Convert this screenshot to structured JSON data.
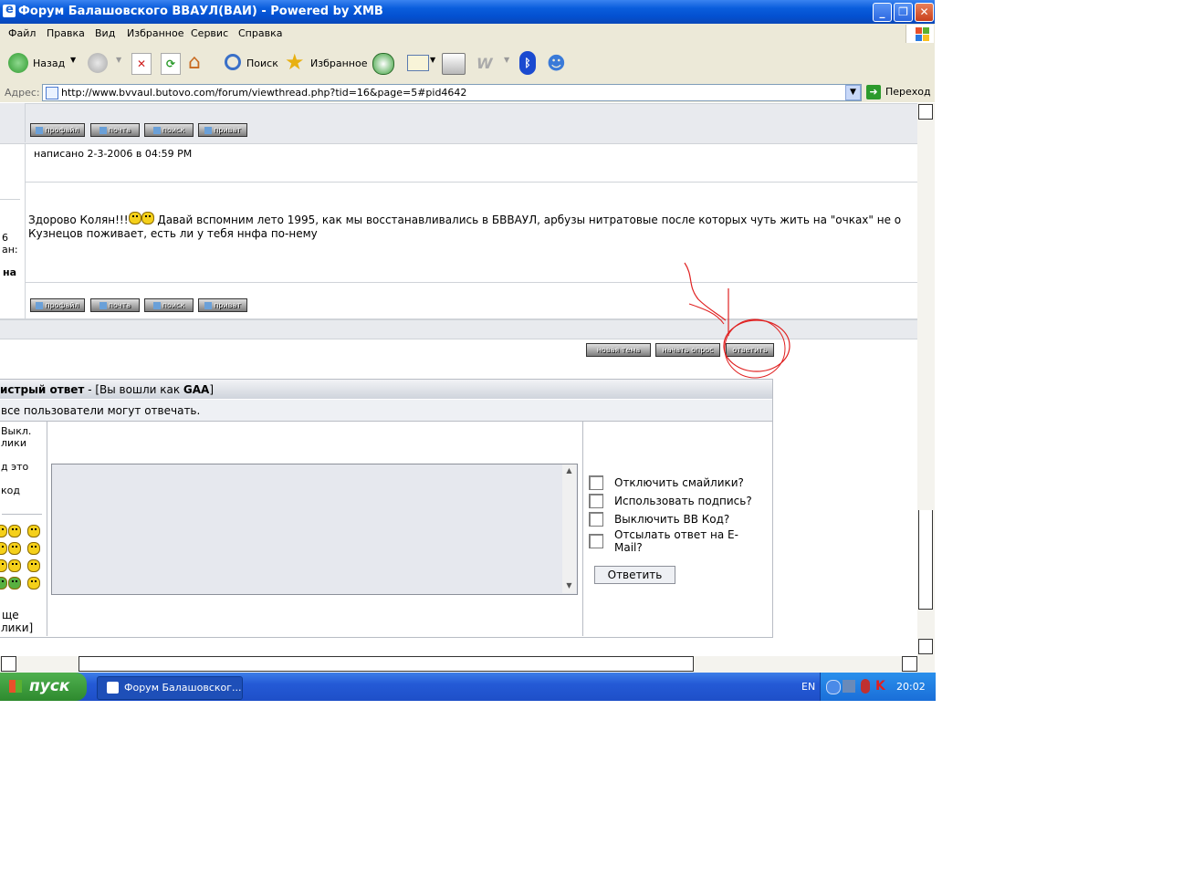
{
  "window": {
    "title": "Форум Балашовского ВВАУЛ(ВАИ) - Powered by XMB",
    "minimize_label": "_",
    "restore_label": "❐",
    "close_label": "✕"
  },
  "menu": [
    "Файл",
    "Правка",
    "Вид",
    "Избранное",
    "Сервис",
    "Справка"
  ],
  "toolbar": {
    "back_label": "Назад",
    "search_label": "Поиск",
    "favorites_label": "Избранное"
  },
  "address": {
    "label": "Адрес:",
    "url": "http://www.bvvaul.butovo.com/forum/viewthread.php?tid=16&page=5#pid4642",
    "go_label": "Переход"
  },
  "post": {
    "buttons": [
      "профайл",
      "почта",
      "поиск",
      "приват"
    ],
    "posted": "написано 2-3-2006 в 04:59 PM",
    "body_line1_a": "Здорово Колян!!!",
    "body_line1_b": "Давай вспомним лето 1995, как мы восстанавливались в БВВАУЛ, арбузы нитратовые после которых чуть жить на \"очках\" не о",
    "body_line2": "Кузнецов поживает, есть ли у тебя ннфа по-нему",
    "side_fragment1": "6",
    "side_fragment2": "ан:",
    "side_fragment3": "на"
  },
  "thread_actions": [
    "новая тема",
    "начать опрос",
    "ответить"
  ],
  "quick_reply": {
    "title": "истрый ответ",
    "logged_in_prefix": " - [Вы вошли как ",
    "user": "GAA",
    "logged_in_suffix": "]",
    "note": "все пользователи могут отвечать.",
    "left_labels": [
      "Выкл.",
      "лики",
      "д это",
      "код"
    ],
    "more_smilies_1": "ще",
    "more_smilies_2": "лики]",
    "options": [
      "Отключить смайлики?",
      "Использовать подпись?",
      "Выключить BB Код?",
      "Отсылать ответ на E-Mail?"
    ],
    "submit_label": "Ответить"
  },
  "taskbar": {
    "start_label": "пуск",
    "task_label": "Форум Балашовског...",
    "lang": "EN",
    "time": "20:02"
  }
}
